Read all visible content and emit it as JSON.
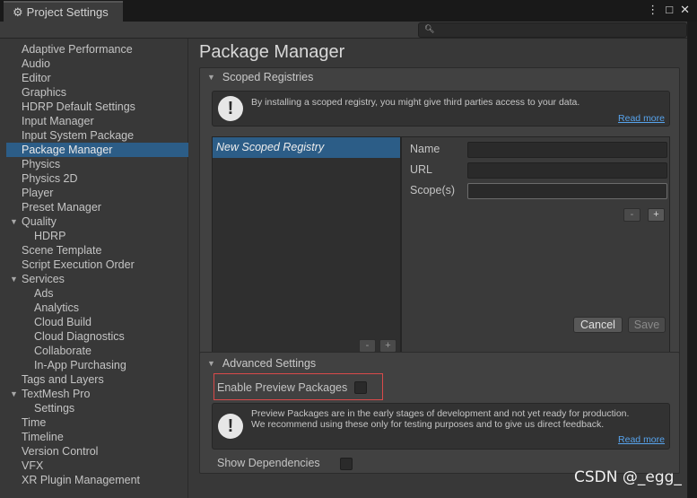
{
  "window": {
    "title": "Project Settings",
    "controls": [
      "⋮",
      "□",
      "✕"
    ]
  },
  "search": {
    "placeholder": "",
    "icon": "search-icon"
  },
  "sidebar": {
    "items": [
      {
        "label": "Adaptive Performance",
        "indent": 0
      },
      {
        "label": "Audio",
        "indent": 0
      },
      {
        "label": "Editor",
        "indent": 0
      },
      {
        "label": "Graphics",
        "indent": 0
      },
      {
        "label": "HDRP Default Settings",
        "indent": 0
      },
      {
        "label": "Input Manager",
        "indent": 0
      },
      {
        "label": "Input System Package",
        "indent": 0
      },
      {
        "label": "Package Manager",
        "indent": 0,
        "selected": true
      },
      {
        "label": "Physics",
        "indent": 0
      },
      {
        "label": "Physics 2D",
        "indent": 0
      },
      {
        "label": "Player",
        "indent": 0
      },
      {
        "label": "Preset Manager",
        "indent": 0
      },
      {
        "label": "Quality",
        "indent": 0,
        "expanded": true
      },
      {
        "label": "HDRP",
        "indent": 1
      },
      {
        "label": "Scene Template",
        "indent": 0
      },
      {
        "label": "Script Execution Order",
        "indent": 0
      },
      {
        "label": "Services",
        "indent": 0,
        "expanded": true
      },
      {
        "label": "Ads",
        "indent": 1
      },
      {
        "label": "Analytics",
        "indent": 1
      },
      {
        "label": "Cloud Build",
        "indent": 1
      },
      {
        "label": "Cloud Diagnostics",
        "indent": 1
      },
      {
        "label": "Collaborate",
        "indent": 1
      },
      {
        "label": "In-App Purchasing",
        "indent": 1
      },
      {
        "label": "Tags and Layers",
        "indent": 0
      },
      {
        "label": "TextMesh Pro",
        "indent": 0,
        "expanded": true
      },
      {
        "label": "Settings",
        "indent": 1
      },
      {
        "label": "Time",
        "indent": 0
      },
      {
        "label": "Timeline",
        "indent": 0
      },
      {
        "label": "Version Control",
        "indent": 0
      },
      {
        "label": "VFX",
        "indent": 0
      },
      {
        "label": "XR Plugin Management",
        "indent": 0
      }
    ]
  },
  "main": {
    "title": "Package Manager",
    "scoped": {
      "header": "Scoped Registries",
      "info_text": "By installing a scoped registry, you might give third parties access to your data.",
      "read_more": "Read more",
      "registry_item": "New Scoped Registry",
      "list_remove": "-",
      "list_add": "+",
      "name_label": "Name",
      "url_label": "URL",
      "scopes_label": "Scope(s)",
      "scope_remove": "-",
      "scope_add": "+",
      "cancel": "Cancel",
      "save": "Save"
    },
    "advanced": {
      "header": "Advanced Settings",
      "enable_preview": "Enable Preview Packages",
      "enable_preview_checked": false,
      "preview_line1": "Preview Packages are in the early stages of development and not yet ready for production.",
      "preview_line2": "We recommend using these only for testing purposes and to give us direct feedback.",
      "read_more": "Read more",
      "show_deps": "Show Dependencies",
      "show_deps_checked": false
    }
  },
  "watermark": "CSDN @_egg_"
}
